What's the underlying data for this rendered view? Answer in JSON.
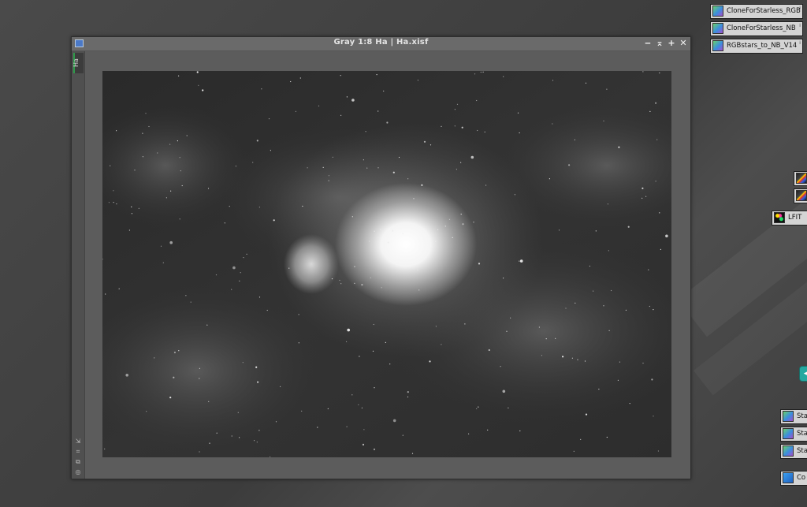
{
  "window": {
    "title": "Gray 1:8 Ha | Ha.xisf",
    "tab_label": "Ha",
    "controls": {
      "minimize": "‒",
      "shade": "⌅",
      "maximize": "+",
      "close": "✕"
    },
    "side_tools": [
      "arrow-icon",
      "frame-icon",
      "clone-icon",
      "settings-icon"
    ]
  },
  "image": {
    "description_subject": "",
    "mode": "grayscale"
  },
  "process_icons": [
    {
      "label": "CloneForStarless_RGB",
      "icon": "script-icon"
    },
    {
      "label": "CloneForStarless_NB",
      "icon": "script-icon"
    },
    {
      "label": "RGBstars_to_NB_V14",
      "icon": "script-icon"
    },
    {
      "label": "",
      "icon": "scope-icon"
    },
    {
      "label": "",
      "icon": "scope-icon"
    },
    {
      "label": "LFIT",
      "icon": "lfit-icon"
    },
    {
      "label": "Sta",
      "icon": "script-icon"
    },
    {
      "label": "Sta",
      "icon": "script-icon"
    },
    {
      "label": "Sta",
      "icon": "script-icon"
    },
    {
      "label": "Co",
      "icon": "gear-icon"
    }
  ],
  "teal_button": {
    "glyph": "◂"
  },
  "colors": {
    "accent_tab": "#2f9a4a",
    "window_icon": "#4b79c7",
    "workspace": "#454545"
  }
}
